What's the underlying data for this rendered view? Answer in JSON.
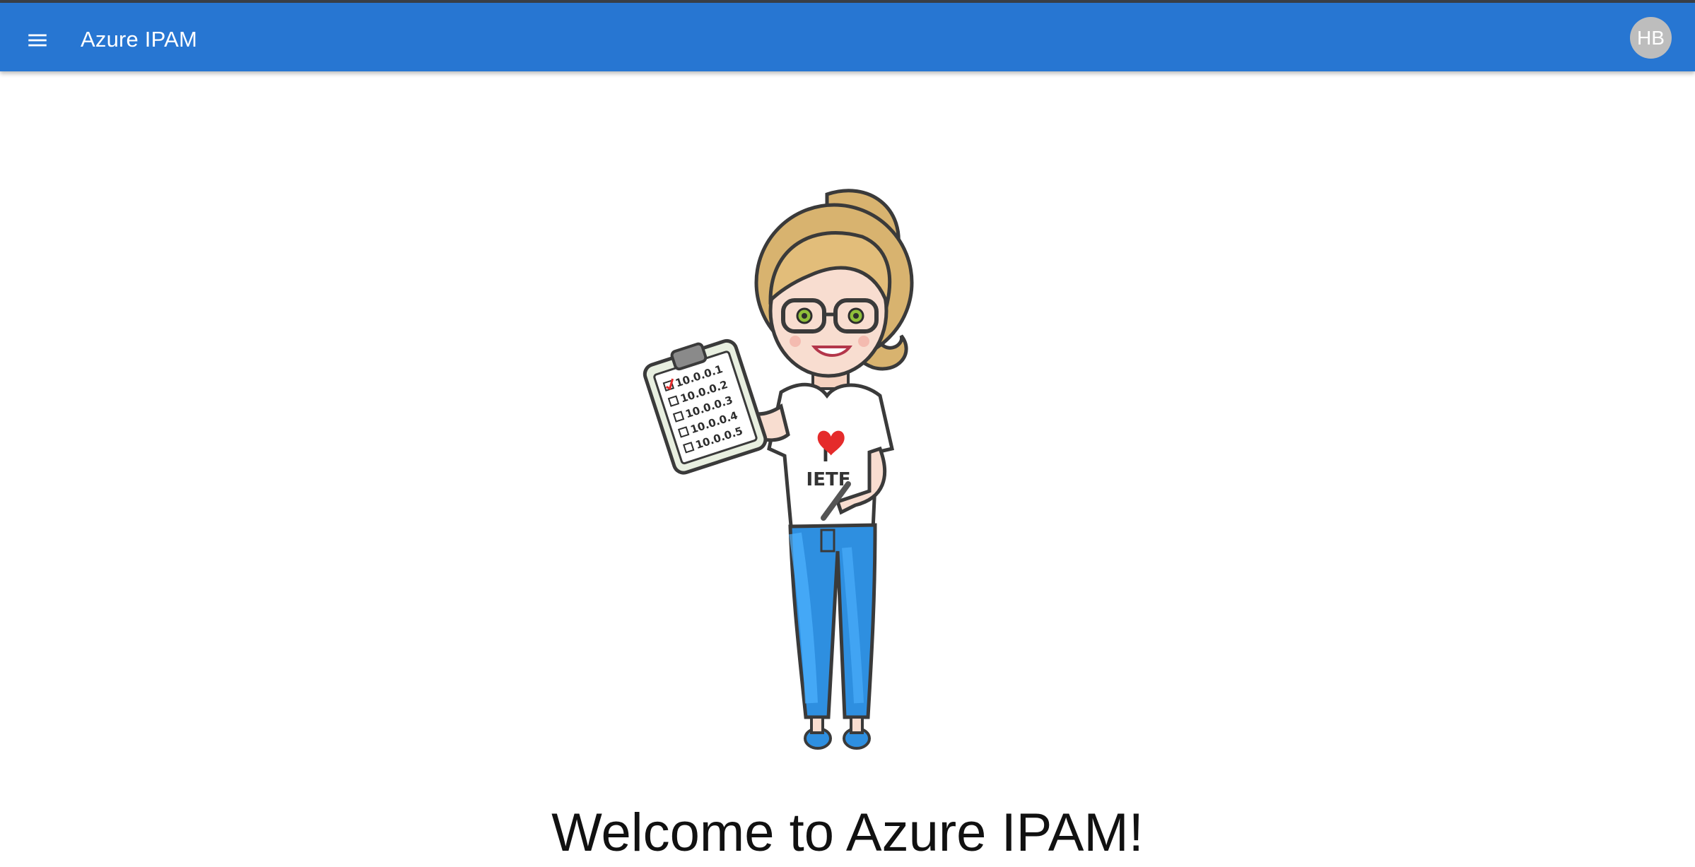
{
  "app_bar": {
    "title": "Azure IPAM",
    "menu_icon": "hamburger-menu-icon",
    "avatar_initials": "HB",
    "colors": {
      "bar": "#2776d2",
      "avatar": "#bdbdbd"
    }
  },
  "illustration": {
    "clipboard_items": [
      "10.0.0.1",
      "10.0.0.2",
      "10.0.0.3",
      "10.0.0.4",
      "10.0.0.5"
    ],
    "shirt_line1": "I",
    "shirt_line2": "IETF"
  },
  "welcome_message": "Welcome to Azure IPAM!"
}
